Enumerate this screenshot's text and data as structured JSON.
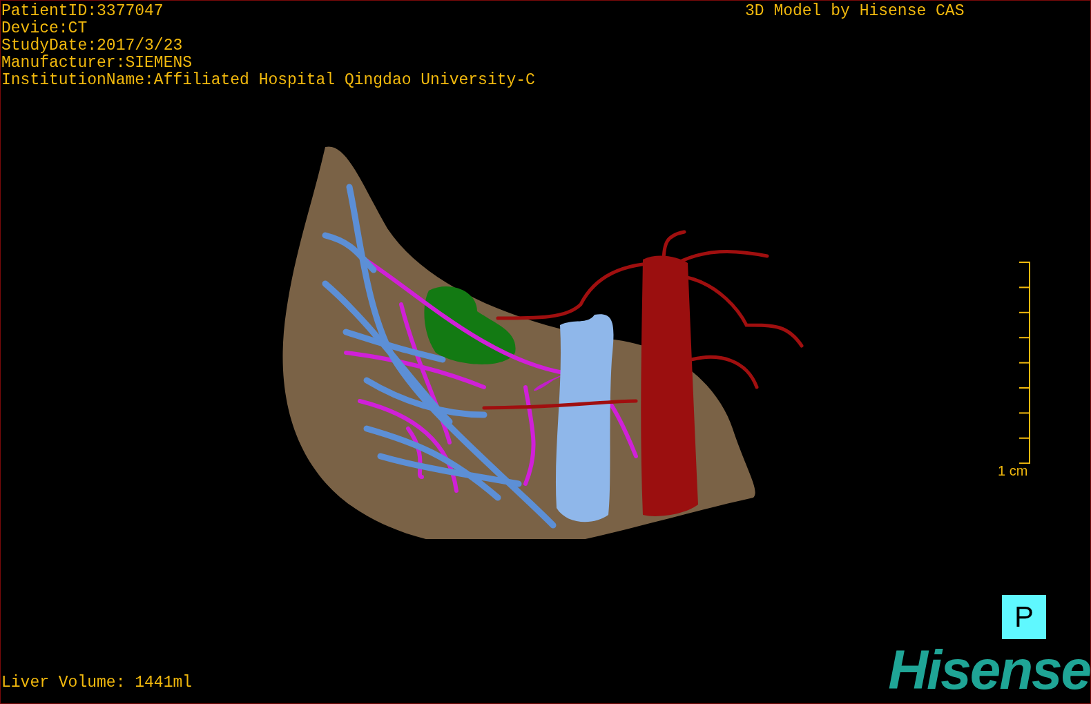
{
  "patient_info": [
    "PatientID:3377047",
    "Device:CT",
    "StudyDate:2017/3/23",
    "Manufacturer:SIEMENS",
    "InstitutionName:Affiliated Hospital Qingdao University-C"
  ],
  "model_caption": "3D Model by Hisense CAS",
  "scale_bar": {
    "label": "1 cm"
  },
  "orientation_marker": {
    "label": "P"
  },
  "logo": {
    "text": "Hisense"
  },
  "liver_volume": "Liver Volume: 1441ml"
}
